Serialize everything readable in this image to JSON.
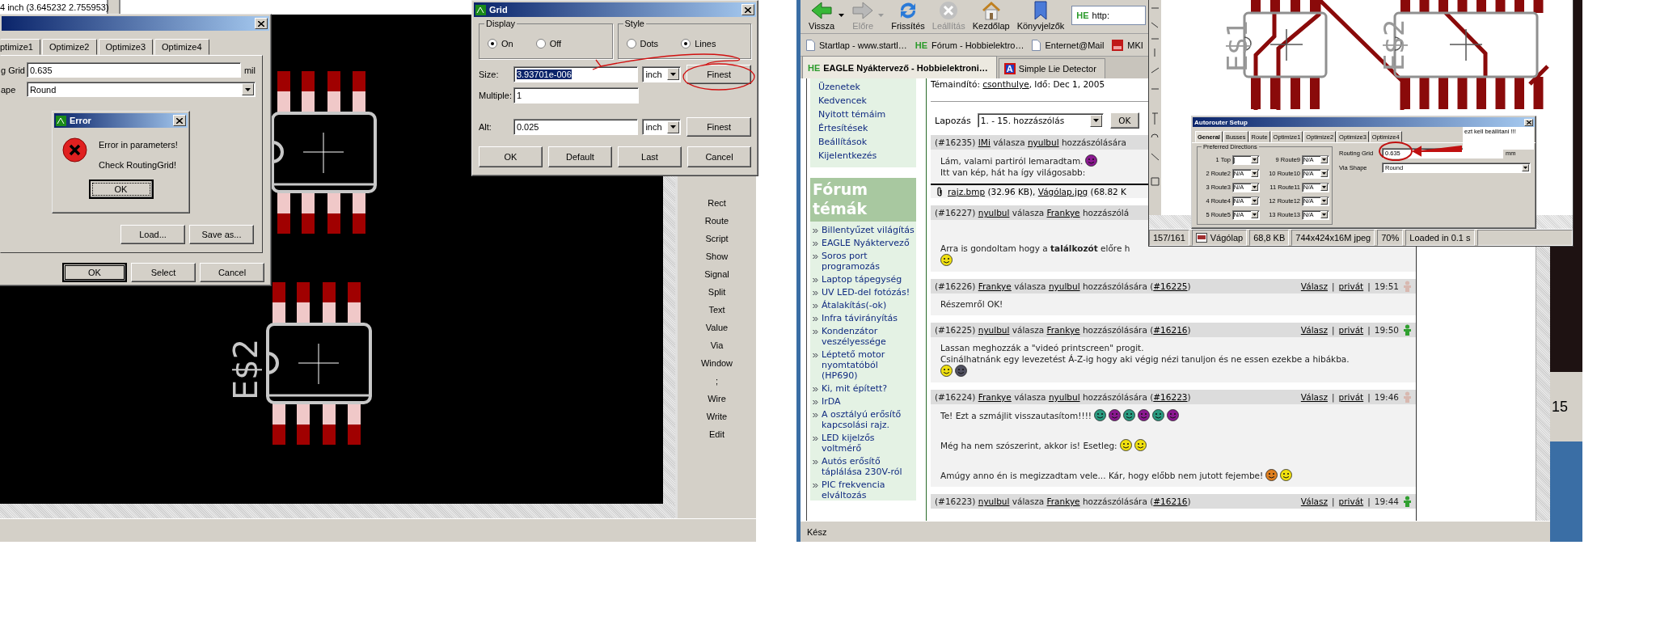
{
  "eagle": {
    "coordinates": "4 inch (3.645232 2.755953)",
    "commands": [
      "Rect",
      "Route",
      "Script",
      "Show",
      "Signal",
      "Split",
      "Text",
      "Value",
      "Via",
      "Window",
      ";",
      "Wire",
      "Write",
      "Edit"
    ],
    "part_label": "E$2",
    "autorouter_dialog": {
      "tabs": [
        {
          "label": "ptimize1",
          "selected": false
        },
        {
          "label": "Optimize2",
          "selected": false
        },
        {
          "label": "Optimize3",
          "selected": false
        },
        {
          "label": "Optimize4",
          "selected": false
        }
      ],
      "routing_grid": {
        "label": "g Grid",
        "value": "0.635",
        "unit": "mil"
      },
      "via_shape": {
        "label": "ape",
        "value": "Round"
      },
      "buttons": [
        "Load...",
        "Save as..."
      ],
      "footer_buttons": [
        {
          "label": "OK",
          "default": true
        },
        {
          "label": "Select",
          "default": false
        },
        {
          "label": "Cancel",
          "default": false
        }
      ]
    },
    "error_dialog": {
      "title": "Error",
      "messages": [
        "Error in parameters!",
        "Check RoutingGrid!"
      ],
      "button": "OK"
    },
    "grid_dialog": {
      "title": "Grid",
      "groups": [
        {
          "label": "Display",
          "options": [
            {
              "label": "On",
              "selected": true
            },
            {
              "label": "Off",
              "selected": false
            }
          ]
        },
        {
          "label": "Style",
          "options": [
            {
              "label": "Dots",
              "selected": false
            },
            {
              "label": "Lines",
              "selected": true
            }
          ]
        }
      ],
      "rows": [
        {
          "label": "Size:",
          "value": "3.93701e-006",
          "highlighted": true,
          "unit": "inch",
          "button": "Finest"
        },
        {
          "label": "Multiple:",
          "value": "1",
          "highlighted": false
        },
        {
          "label": "Alt:",
          "value": "0.025",
          "highlighted": false,
          "unit": "inch",
          "button": "Finest"
        }
      ],
      "buttons": [
        "OK",
        "Default",
        "Last",
        "Cancel"
      ]
    }
  },
  "browser": {
    "toolbar": [
      {
        "kind": "back",
        "label": "Vissza",
        "disabled": false,
        "dropdown": true
      },
      {
        "kind": "forward",
        "label": "Előre",
        "disabled": true,
        "dropdown": true
      },
      {
        "kind": "refresh",
        "label": "Frissítés",
        "disabled": false,
        "dropdown": false
      },
      {
        "kind": "stop",
        "label": "Leállítás",
        "disabled": true,
        "dropdown": false
      },
      {
        "kind": "home",
        "label": "Kezdőlap",
        "disabled": false,
        "dropdown": false
      },
      {
        "kind": "bookmarks",
        "label": "Könyvjelzők",
        "disabled": false,
        "dropdown": false
      }
    ],
    "address": {
      "logo": "HE",
      "value": "http:"
    },
    "bookmarks": [
      {
        "label": "Startlap - www.startl…",
        "icon": {
          "kind": "page"
        }
      },
      {
        "label": "Fórum - Hobbielektro…",
        "icon": {
          "kind": "logo",
          "text": "HE"
        }
      },
      {
        "label": "Enternet@Mail",
        "icon": {
          "kind": "page"
        }
      },
      {
        "label": "MKI",
        "icon": {
          "kind": "image"
        }
      }
    ],
    "tabs": [
      {
        "label": "EAGLE Nyáktervező - Hobbielektroni…",
        "selected": true,
        "icon": {
          "kind": "logo",
          "text": "HE"
        }
      },
      {
        "label": "Simple Lie Detector",
        "selected": false,
        "icon": {
          "kind": "badge",
          "text": "A"
        }
      }
    ],
    "forum": {
      "nav": [
        "Üzenetek",
        "Kedvencek",
        "Nyitott témáim",
        "Értesítések",
        "Beállítások",
        "Kijelentkezés"
      ],
      "topics_title": "Fórum témák",
      "topics": [
        "Billentyűzet világítás",
        "EAGLE Nyáktervező",
        "Soros port programozás",
        "Laptop tápegység",
        "UV LED-del fotózás!",
        "Átalakítás(-ok)",
        "Infra távirányítás",
        "Kondenzátor veszélyessége",
        "Léptető motor nyomtatóból (HP690)",
        "Ki, mit épített?",
        "IrDA",
        "A osztályú erősítő kapcsolási rajz.",
        "LED kijelzős voltmérő",
        "Autós erősítő táplálása 230V-ról",
        "PIC frekvencia elváltozás"
      ],
      "starter": [
        {
          "text": "Témaindító: ",
          "link": false
        },
        {
          "text": "csonthulye",
          "link": true
        },
        {
          "text": ", Idő: Dec 1, 2005",
          "link": false
        }
      ],
      "pager": {
        "label": "Lapozás",
        "value": "1. - 15. hozzászólás",
        "button": "OK"
      },
      "posts": [
        {
          "byline": [
            {
              "text": "(#16235) ",
              "link": false
            },
            {
              "text": "IMi",
              "link": true
            },
            {
              "text": " válasza ",
              "link": false
            },
            {
              "text": "nyulbul",
              "link": true
            },
            {
              "text": " hozzászólására",
              "link": false
            }
          ],
          "lines": [
            {
              "text": "Lám, valami partiról lemaradtam.",
              "smileys": [
                {
                  "color": "#8a1890"
                }
              ]
            },
            {
              "text": "Itt van kép, hát ha így világosabb:"
            }
          ],
          "attachment": [
            {
              "text": "rajz.bmp",
              "link": true
            },
            {
              "text": " (32.96 KB), ",
              "link": false
            },
            {
              "text": "Vágólap.jpg",
              "link": true
            },
            {
              "text": " (68.82 K",
              "link": false
            }
          ]
        },
        {
          "byline": [
            {
              "text": "(#16227) ",
              "link": false
            },
            {
              "text": "nyulbul",
              "link": true
            },
            {
              "text": " válasza ",
              "link": false
            },
            {
              "text": "Frankye",
              "link": true
            },
            {
              "text": " hozzászólá",
              "link": false
            }
          ],
          "lines": [
            {
              "text": "Arra is gondoltam hogy a **találkozót** előre h",
              "spaced": true
            },
            {
              "smileys": [
                {
                  "color": "#f0e010"
                }
              ]
            }
          ]
        },
        {
          "byline": [
            {
              "text": "(#16226) ",
              "link": false
            },
            {
              "text": "Frankye",
              "link": true
            },
            {
              "text": " válasza ",
              "link": false
            },
            {
              "text": "nyulbul",
              "link": true
            },
            {
              "text": " hozzászólására (",
              "link": false
            },
            {
              "text": "#16225",
              "link": true
            },
            {
              "text": ")",
              "link": false
            }
          ],
          "actions": {
            "reply": "Válasz",
            "separator": "|",
            "private": "privát",
            "time": "19:51",
            "online": false
          },
          "lines": [
            {
              "text": "Részemről OK!"
            }
          ]
        },
        {
          "byline": [
            {
              "text": "(#16225) ",
              "link": false
            },
            {
              "text": "nyulbul",
              "link": true
            },
            {
              "text": " válasza ",
              "link": false
            },
            {
              "text": "Frankye",
              "link": true
            },
            {
              "text": " hozzászólására (",
              "link": false
            },
            {
              "text": "#16216",
              "link": true
            },
            {
              "text": ")",
              "link": false
            }
          ],
          "actions": {
            "reply": "Válasz",
            "separator": "|",
            "private": "privát",
            "time": "19:50",
            "online": true
          },
          "lines": [
            {
              "text": "Lassan meghozzák a \"videó printscreen\" progit."
            },
            {
              "text": "Csinálhatnánk egy levezetést Á-Z-ig hogy aki végig nézi tanuljon és ne essen ezekbe a hibákba."
            },
            {
              "smileys": [
                {
                  "color": "#f0e010"
                },
                {
                  "color": "#505060"
                }
              ]
            }
          ]
        },
        {
          "byline": [
            {
              "text": "(#16224) ",
              "link": false
            },
            {
              "text": "Frankye",
              "link": true
            },
            {
              "text": " válasza ",
              "link": false
            },
            {
              "text": "nyulbul",
              "link": true
            },
            {
              "text": " hozzászólására (",
              "link": false
            },
            {
              "text": "#16223",
              "link": true
            },
            {
              "text": ")",
              "link": false
            }
          ],
          "actions": {
            "reply": "Válasz",
            "separator": "|",
            "private": "privát",
            "time": "19:46",
            "online": false
          },
          "lines": [
            {
              "text": "Te! Ezt a szmájlit visszautasítom!!!!",
              "smileys": [
                {
                  "color": "#2a9a80"
                },
                {
                  "color": "#8a1890"
                },
                {
                  "color": "#2a9a80"
                },
                {
                  "color": "#8a1890"
                },
                {
                  "color": "#2a9a80"
                },
                {
                  "color": "#8a1890"
                }
              ]
            },
            {
              "text": "Még ha nem szószerint, akkor is! Esetleg:",
              "spaced": true,
              "smileys": [
                {
                  "color": "#f0e010"
                },
                {
                  "color": "#f0e010"
                }
              ]
            },
            {
              "text": "Amúgy anno én is megizzadtam vele... Kár, hogy előbb nem jutott fejembe!",
              "spaced": true,
              "smileys": [
                {
                  "color": "#e08020"
                },
                {
                  "color": "#f0e010"
                }
              ]
            }
          ]
        },
        {
          "byline": [
            {
              "text": "(#16223) ",
              "link": false
            },
            {
              "text": "nyulbul",
              "link": true
            },
            {
              "text": " válasza ",
              "link": false
            },
            {
              "text": "Frankye",
              "link": true
            },
            {
              "text": " hozzászólására (",
              "link": false
            },
            {
              "text": "#16216",
              "link": true
            },
            {
              "text": ")",
              "link": false
            }
          ],
          "actions": {
            "reply": "Válasz",
            "separator": "|",
            "private": "privát",
            "time": "19:44",
            "online": true
          }
        }
      ]
    },
    "status": "Kész"
  },
  "behind_window": {
    "text": "15"
  },
  "image_viewer": {
    "part_labels": [
      "E$1",
      "E$2"
    ],
    "dialog": {
      "title": "Autorouter Setup",
      "tabs": [
        {
          "label": "General",
          "selected": true
        },
        {
          "label": "Busses",
          "selected": false
        },
        {
          "label": "Route",
          "selected": false
        },
        {
          "label": "Optimize1",
          "selected": false
        },
        {
          "label": "Optimize2",
          "selected": false
        },
        {
          "label": "Optimize3",
          "selected": false
        },
        {
          "label": "Optimize4",
          "selected": false
        }
      ],
      "group": "Preferred Directions",
      "layers": [
        {
          "label": "1 Top",
          "value": "|"
        },
        {
          "label": "2 Route2",
          "value": "N/A"
        },
        {
          "label": "3 Route3",
          "value": "N/A"
        },
        {
          "label": "4 Route4",
          "value": "N/A"
        },
        {
          "label": "5 Route5",
          "value": "N/A"
        },
        {
          "label": "9 Route9",
          "value": "N/A"
        },
        {
          "label": "10 Route10",
          "value": "N/A"
        },
        {
          "label": "11 Route11",
          "value": "N/A"
        },
        {
          "label": "12 Route12",
          "value": "N/A"
        },
        {
          "label": "13 Route13",
          "value": "N/A"
        }
      ],
      "routing_grid": {
        "label": "Routing Grid",
        "value": "0.635",
        "unit": "mm"
      },
      "via_shape": {
        "label": "Via Shape",
        "value": "Round"
      }
    },
    "note": "ezt kell beállítani !!!",
    "status": [
      {
        "text": "157/161",
        "kind": "plain"
      },
      {
        "text": "Vágólap",
        "kind": "file"
      },
      {
        "text": "68,8 KB",
        "kind": "plain"
      },
      {
        "text": "744x424x16M jpeg",
        "kind": "plain"
      },
      {
        "text": "70%",
        "kind": "plain"
      },
      {
        "text": "Loaded in 0.1 s",
        "kind": "plain"
      }
    ]
  }
}
